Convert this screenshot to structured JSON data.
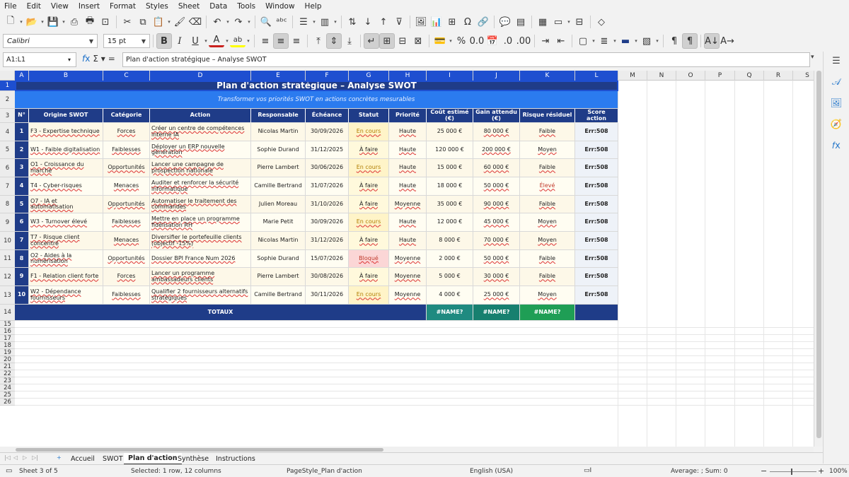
{
  "menubar": [
    "File",
    "Edit",
    "View",
    "Insert",
    "Format",
    "Styles",
    "Sheet",
    "Data",
    "Tools",
    "Window",
    "Help"
  ],
  "toolbar2": {
    "font_name": "Calibri",
    "font_size": "15 pt"
  },
  "formula": {
    "cell_ref": "A1:L1",
    "content": "Plan d'action stratégique – Analyse SWOT"
  },
  "icons": {
    "tb1": [
      "new-icon",
      "open-icon",
      "save-icon",
      "export-pdf-icon",
      "print-icon",
      "print-preview-icon",
      "cut-icon",
      "copy-icon",
      "paste-icon",
      "clone-format-icon",
      "clear-format-icon",
      "undo-icon",
      "redo-icon",
      "find-replace-icon",
      "spellcheck-icon",
      "row-icon",
      "column-icon",
      "sort-icon",
      "sort-ascending-icon",
      "sort-descending-icon",
      "autofilter-icon",
      "image-icon",
      "chart-icon",
      "pivot-table-icon",
      "special-character-icon",
      "hyperlink-icon",
      "comment-icon",
      "header-footer-icon",
      "define-print-area-icon",
      "freeze-rows-icon",
      "split-window-icon",
      "show-draw-functions-icon"
    ],
    "tb2": [
      "bold-icon",
      "italic-icon",
      "underline-icon",
      "font-color-icon",
      "highlight-icon",
      "align-left-icon",
      "align-center-icon",
      "align-right-icon",
      "align-top-icon",
      "center-vertically-icon",
      "align-bottom-icon",
      "wrap-text-icon",
      "merge-center-icon",
      "merge-cells-icon",
      "unmerge-cells-icon",
      "currency-icon",
      "percent-icon",
      "number-format-icon",
      "date-icon",
      "add-decimal-icon",
      "delete-decimal-icon",
      "increase-indent-icon",
      "decrease-indent-icon",
      "borders-icon",
      "border-style-icon",
      "border-color-icon",
      "conditional-format-icon",
      "left-to-right-icon",
      "right-to-left-icon",
      "text-top-to-bottom-icon",
      "text-left-to-right-icon"
    ],
    "sidebar": [
      "properties-icon",
      "styles-icon",
      "gallery-icon",
      "navigator-icon",
      "functions-icon"
    ]
  },
  "columns": [
    "A",
    "B",
    "C",
    "D",
    "E",
    "F",
    "G",
    "H",
    "I",
    "J",
    "K",
    "L",
    "M",
    "N",
    "O",
    "P",
    "Q",
    "R",
    "S"
  ],
  "rows": [
    "1",
    "2",
    "3",
    "4",
    "5",
    "6",
    "7",
    "8",
    "9",
    "10",
    "11",
    "12",
    "13",
    "14",
    "15",
    "16",
    "17",
    "18",
    "19",
    "20",
    "21",
    "22",
    "23",
    "24",
    "25",
    "26"
  ],
  "sheet": {
    "title": "Plan d'action stratégique – Analyse SWOT",
    "subtitle": "Transformer vos priorités SWOT en actions concrètes mesurables",
    "headers": [
      "N°",
      "Origine SWOT",
      "Catégorie",
      "Action",
      "Responsable",
      "Échéance",
      "Statut",
      "Priorité",
      "Coût estimé (€)",
      "Gain attendu (€)",
      "Risque résiduel",
      "Score action"
    ],
    "rows": [
      [
        "1",
        "F3 - Expertise technique",
        "Forces",
        "Créer un centre de compétences interne IA",
        "Nicolas Martin",
        "30/09/2026",
        "En cours",
        "Haute",
        "25 000 €",
        "80 000 €",
        "Faible",
        "Err:508"
      ],
      [
        "2",
        "W1 - Faible digitalisation",
        "Faiblesses",
        "Déployer un ERP nouvelle génération",
        "Sophie Durand",
        "31/12/2025",
        "À faire",
        "Haute",
        "120 000 €",
        "200 000 €",
        "Moyen",
        "Err:508"
      ],
      [
        "3",
        "O1 - Croissance du marché",
        "Opportunités",
        "Lancer une campagne de prospection nationale",
        "Pierre Lambert",
        "30/06/2026",
        "En cours",
        "Haute",
        "15 000 €",
        "60 000 €",
        "Faible",
        "Err:508"
      ],
      [
        "4",
        "T4 - Cyber-risques",
        "Menaces",
        "Auditer et renforcer la sécurité informatique",
        "Camille Bertrand",
        "31/07/2026",
        "À faire",
        "Haute",
        "18 000 €",
        "50 000 €",
        "Élevé",
        "Err:508"
      ],
      [
        "5",
        "O7 - IA et automatisation",
        "Opportunités",
        "Automatiser le traitement des commandes",
        "Julien Moreau",
        "31/10/2026",
        "À faire",
        "Moyenne",
        "35 000 €",
        "90 000 €",
        "Faible",
        "Err:508"
      ],
      [
        "6",
        "W3 - Turnover élevé",
        "Faiblesses",
        "Mettre en place un programme fidélisation RH",
        "Marie Petit",
        "30/09/2026",
        "En cours",
        "Haute",
        "12 000 €",
        "45 000 €",
        "Moyen",
        "Err:508"
      ],
      [
        "7",
        "T7 - Risque client concentré",
        "Menaces",
        "Diversifier le portefeuille clients (objectif -15%)",
        "Nicolas Martin",
        "31/12/2026",
        "À faire",
        "Haute",
        "8 000 €",
        "70 000 €",
        "Moyen",
        "Err:508"
      ],
      [
        "8",
        "O2 - Aides à la numérisation",
        "Opportunités",
        "Dossier BPI France Num 2026",
        "Sophie Durand",
        "15/07/2026",
        "Bloqué",
        "Moyenne",
        "2 000 €",
        "50 000 €",
        "Faible",
        "Err:508"
      ],
      [
        "9",
        "F1 - Relation client forte",
        "Forces",
        "Lancer un programme ambassadeurs clients",
        "Pierre Lambert",
        "30/08/2026",
        "À faire",
        "Moyenne",
        "5 000 €",
        "30 000 €",
        "Faible",
        "Err:508"
      ],
      [
        "10",
        "W2 - Dépendance fournisseurs",
        "Faiblesses",
        "Qualifier 2 fournisseurs alternatifs stratégiques",
        "Camille Bertrand",
        "30/11/2026",
        "En cours",
        "Moyenne",
        "4 000 €",
        "25 000 €",
        "Moyen",
        "Err:508"
      ]
    ],
    "totals_label": "TOTAUX",
    "totals": [
      "#NAME?",
      "#NAME?",
      "#NAME?"
    ]
  },
  "tabs": {
    "nav_icons": [
      "first-sheet-icon",
      "prev-sheet-icon",
      "next-sheet-icon",
      "last-sheet-icon",
      "add-sheet-icon"
    ],
    "names": [
      "Accueil",
      "SWOT",
      "Plan d'action",
      "Synthèse",
      "Instructions"
    ],
    "active": 2
  },
  "status": {
    "sheet": "Sheet 3 of 5",
    "selection": "Selected: 1 row, 12 columns",
    "page_style": "PageStyle_Plan d'action",
    "language": "English (USA)",
    "sum": "Average: ; Sum: 0",
    "zoom": "100%",
    "zoom_minus": "−",
    "zoom_plus": "+"
  },
  "colors": {
    "title_bg": "#1f3c88",
    "subtitle_bg": "#2b7bef",
    "header_bg": "#1f3c88",
    "row_bg": "#fdf8e8",
    "row_bg_alt": "#fffdf2",
    "num_bg": "#1f3c88",
    "score_bg": "#eef2f8",
    "status_encours": "#fff4c8",
    "status_afaire": "#fff9dc",
    "status_bloque": "#fbd6d6",
    "total_cost": "#1f8a80",
    "total_gain": "#17806f",
    "total_risk": "#1f9e55",
    "selection": "#1e4fd0"
  }
}
